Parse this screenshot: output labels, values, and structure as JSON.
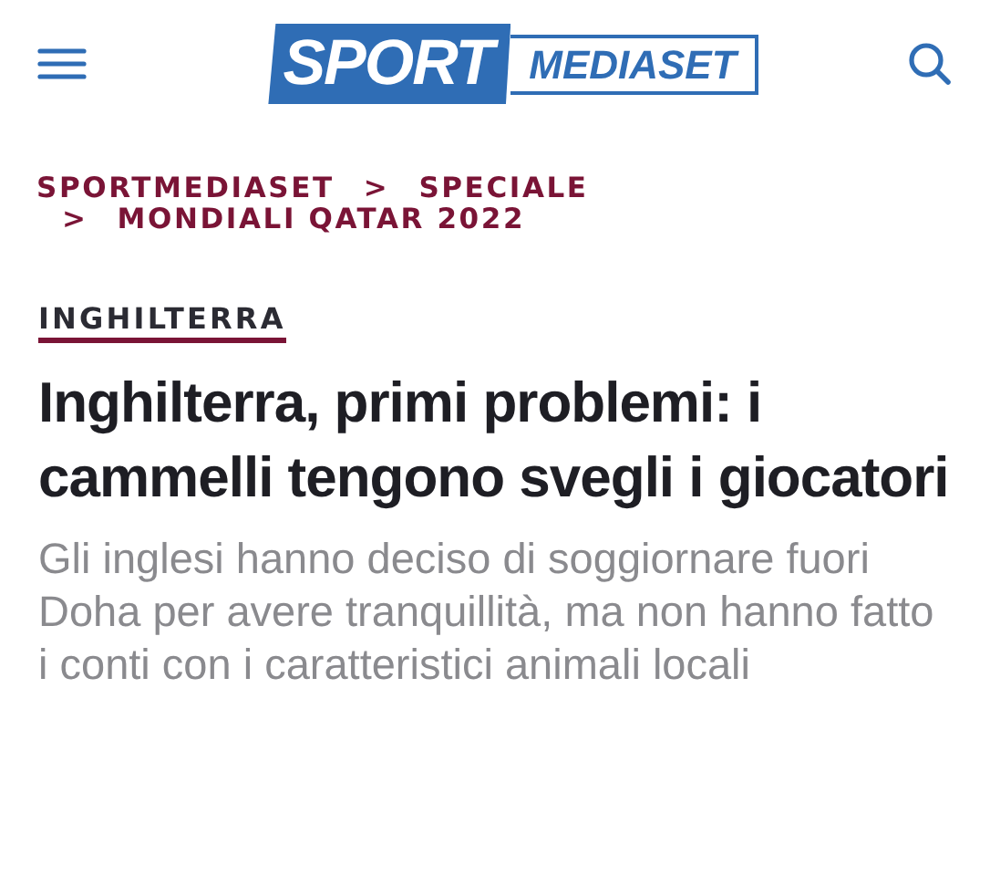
{
  "header": {
    "logo": {
      "primary": "SPORT",
      "secondary": "MEDIASET"
    }
  },
  "breadcrumbs": [
    {
      "label": "SPORTMEDIASET"
    },
    {
      "separator": ">",
      "label": "SPECIALE"
    },
    {
      "separator": ">",
      "label": "MONDIALI QATAR 2022"
    }
  ],
  "category": "INGHILTERRA",
  "headline": "Inghilterra, primi problemi: i cammelli tengono svegli i giocatori",
  "summary": "Gli inglesi hanno deciso di soggiornare fuori Doha per avere tranquillità, ma non hanno fatto i conti con i caratteristici animali locali"
}
